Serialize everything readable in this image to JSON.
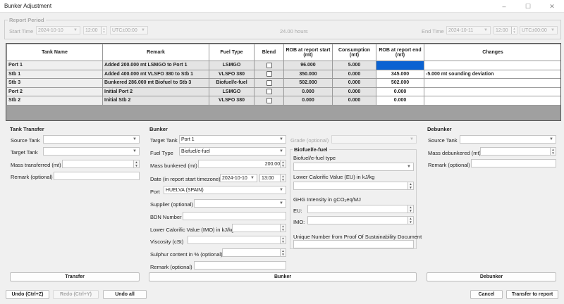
{
  "window": {
    "title": "Bunker Adjustment",
    "minimize": "–",
    "maximize": "☐",
    "close": "✕"
  },
  "report_period": {
    "legend": "Report Period",
    "start_label": "Start Time",
    "start_date": "2024-10-10",
    "start_time": "12:00",
    "start_tz": "UTC±00:00",
    "duration": "24.00 hours",
    "end_label": "End Time",
    "end_date": "2024-10-11",
    "end_time": "12:00",
    "end_tz": "UTC±00:00"
  },
  "grid": {
    "headers": [
      "Tank Name",
      "Remark",
      "Fuel Type",
      "Blend",
      "ROB at report start (mt)",
      "Consumption (mt)",
      "ROB at report end (mt)",
      "Changes"
    ],
    "rows": [
      {
        "tank": "Port 1",
        "remark": "Added 200.000 mt LSMGO to Port 1",
        "fuel": "LSMGO",
        "rob_start": "96.000",
        "consumption": "5.000",
        "rob_end": "",
        "changes": ""
      },
      {
        "tank": "Stb 1",
        "remark": "Added 400.000 mt VLSFO 380 to Stb 1",
        "fuel": "VLSFO 380",
        "rob_start": "350.000",
        "consumption": "0.000",
        "rob_end": "345.000",
        "changes": "-5.000 mt sounding deviation"
      },
      {
        "tank": "Stb 3",
        "remark": "Bunkered 286.000 mt Biofuel to Stb 3",
        "fuel": "Biofuel/e-fuel",
        "rob_start": "502.000",
        "consumption": "0.000",
        "rob_end": "502.000",
        "changes": ""
      },
      {
        "tank": "Port 2",
        "remark": "Initial Port 2",
        "fuel": "LSMGO",
        "rob_start": "0.000",
        "consumption": "0.000",
        "rob_end": "0.000",
        "changes": ""
      },
      {
        "tank": "Stb 2",
        "remark": "Initial Stb 2",
        "fuel": "VLSFO 380",
        "rob_start": "0.000",
        "consumption": "0.000",
        "rob_end": "0.000",
        "changes": ""
      }
    ]
  },
  "tank_transfer": {
    "legend": "Tank Transfer",
    "source_label": "Source Tank",
    "target_label": "Target Tank",
    "mass_label": "Mass transferred (mt)",
    "remark_label": "Remark (optional)",
    "button": "Transfer"
  },
  "bunker": {
    "legend": "Bunker",
    "target_label": "Target Tank",
    "target_value": "Port 1",
    "fuel_label": "Fuel Type",
    "fuel_value": "Biofuel/e-fuel",
    "mass_label": "Mass bunkered (mt)",
    "mass_value": "200.000",
    "date_label": "Date (in report start timezone)",
    "date_value": "2024-10-10",
    "time_value": "13:00",
    "port_label": "Port",
    "port_value": "HUELVA (SPAIN)",
    "supplier_label": "Supplier (optional)",
    "bdn_label": "BDN Number",
    "lcv_label": "Lower Calorific Value (IMO) in kJ/kg",
    "viscosity_label": "Viscosity (cSt)",
    "sulphur_label": "Sulphur content in % (optional)",
    "remark_label": "Remark (optional)",
    "grade_label": "Grade (optional)",
    "bio_legend": "Biofuel/e-fuel",
    "bio_type_label": "Biofuel/e-fuel type",
    "lcv_eu_label": "Lower Calorific Value (EU) in kJ/kg",
    "ghg_label": "GHG Intensity in gCO₂eq/MJ",
    "eu_label": "EU:",
    "imo_label": "IMO:",
    "pos_label": "Unique Number from Proof Of Sustainability Document",
    "button": "Bunker"
  },
  "debunker": {
    "legend": "Debunker",
    "source_label": "Source Tank",
    "mass_label": "Mass debunkered (mt)",
    "remark_label": "Remark (optional)",
    "button": "Debunker"
  },
  "footer": {
    "undo": "Undo (Ctrl+Z)",
    "redo": "Redo (Ctrl+Y)",
    "undo_all": "Undo all",
    "cancel": "Cancel",
    "transfer_to_report": "Transfer to report"
  },
  "icons": {
    "combo": "chevron-down-icon",
    "spin": "spin-arrows-icon"
  }
}
